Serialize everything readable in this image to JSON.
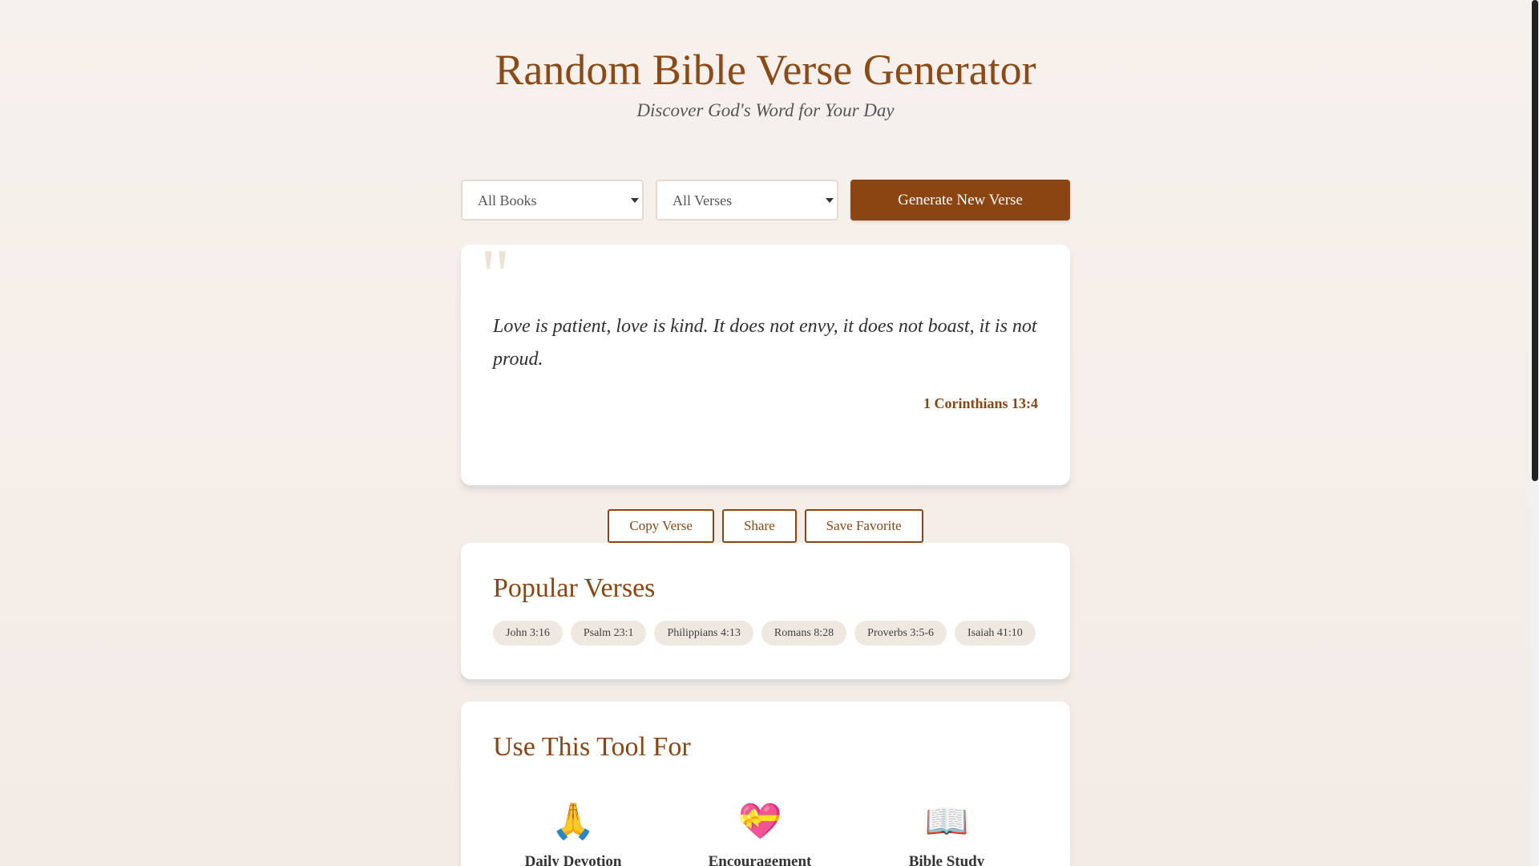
{
  "header": {
    "title": "Random Bible Verse Generator",
    "subtitle": "Discover God's Word for Your Day"
  },
  "controls": {
    "book_select": {
      "selected": "All Books"
    },
    "verse_select": {
      "selected": "All Verses"
    },
    "generate_label": "Generate New Verse"
  },
  "verse": {
    "quote_mark": "\"",
    "text": "Love is patient, love is kind. It does not envy, it does not boast, it is not proud.",
    "reference": "1 Corinthians 13:4"
  },
  "actions": {
    "copy_label": "Copy Verse",
    "share_label": "Share",
    "favorite_label": "Save Favorite"
  },
  "popular": {
    "title": "Popular Verses",
    "tags": [
      "John 3:16",
      "Psalm 23:1",
      "Philippians 4:13",
      "Romans 8:28",
      "Proverbs 3:5-6",
      "Isaiah 41:10"
    ]
  },
  "uses": {
    "title": "Use This Tool For",
    "items": [
      {
        "icon": "🙏",
        "icon_name": "praying-hands-icon",
        "label": "Daily Devotion"
      },
      {
        "icon": "💝",
        "icon_name": "heart-gift-icon",
        "label": "Encouragement"
      },
      {
        "icon": "📖",
        "icon_name": "open-book-icon",
        "label": "Bible Study"
      }
    ]
  },
  "colors": {
    "accent": "#8b4513",
    "background": "#f6f0ec",
    "card": "#ffffff",
    "tag": "#efe8e1"
  }
}
